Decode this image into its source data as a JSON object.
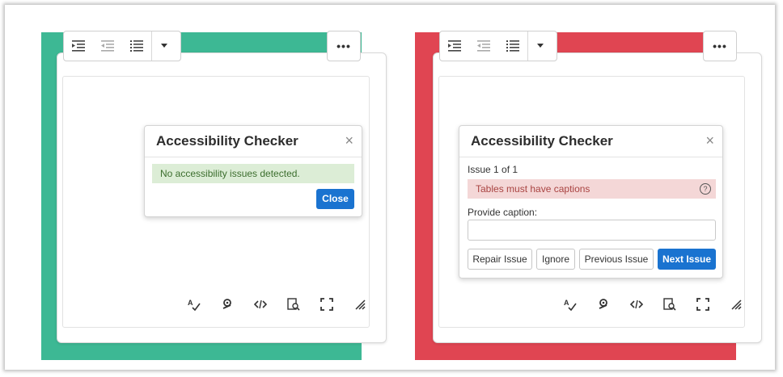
{
  "colors": {
    "pass_bg": "#3db894",
    "fail_bg": "#e04552",
    "primary": "#1a73d0"
  },
  "toolbar": {
    "icons": [
      "indent-icon",
      "outdent-icon",
      "bullet-list-icon",
      "chevron-down-icon"
    ],
    "more_label": "•••"
  },
  "status_icons": [
    "spellcheck-icon",
    "accessibility-icon",
    "code-icon",
    "preview-icon",
    "fullscreen-icon",
    "resize-handle-icon"
  ],
  "left": {
    "dialog": {
      "title": "Accessibility Checker",
      "close_label": "×",
      "message": "No accessibility issues detected.",
      "close_button": "Close"
    }
  },
  "right": {
    "dialog": {
      "title": "Accessibility Checker",
      "close_label": "×",
      "issue_count": "Issue 1 of 1",
      "issue_message": "Tables must have captions",
      "help_label": "?",
      "caption_label": "Provide caption:",
      "caption_value": "",
      "buttons": {
        "repair": "Repair Issue",
        "ignore": "Ignore",
        "previous": "Previous Issue",
        "next": "Next Issue"
      }
    }
  }
}
